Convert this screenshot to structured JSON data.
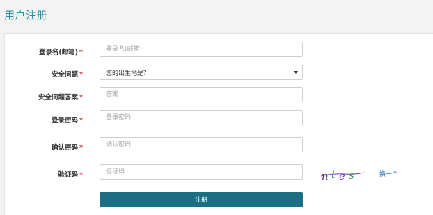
{
  "page": {
    "title": "用户注册"
  },
  "form": {
    "required_mark": "*",
    "username": {
      "label": "登录名(邮箱)",
      "placeholder": "登录名(邮箱)",
      "value": ""
    },
    "security_question": {
      "label": "安全问题",
      "selected": "您的出生地是？"
    },
    "security_answer": {
      "label": "安全问题答案",
      "placeholder": "答案",
      "value": ""
    },
    "password": {
      "label": "登录密码",
      "placeholder": "登录密码",
      "value": ""
    },
    "confirm_password": {
      "label": "确认密码",
      "placeholder": "确认密码",
      "value": ""
    },
    "captcha": {
      "label": "验证码",
      "placeholder": "验证码",
      "value": "",
      "image_text": "ntes",
      "refresh_label": "换一个"
    },
    "submit_label": "注册"
  },
  "colors": {
    "accent": "#2a8da0",
    "button": "#1b6f82",
    "required": "#d9272e",
    "link": "#2a7ab8"
  }
}
